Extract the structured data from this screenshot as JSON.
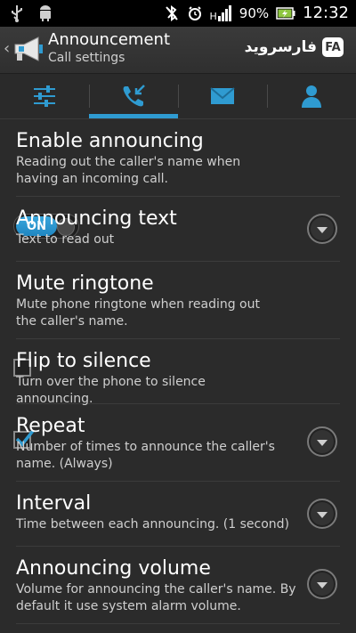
{
  "status_bar": {
    "left_icons": [
      "usb-icon",
      "android-icon"
    ],
    "right_icons": [
      "bluetooth-off-icon",
      "alarm-clock-icon",
      "signal-icon",
      "battery-charging-icon"
    ],
    "network_label": "H",
    "battery": "90%",
    "time": "12:32"
  },
  "action_bar": {
    "back": "‹",
    "title": "Announcement",
    "subtitle": "Call settings",
    "brand_text": "فارسروید",
    "brand_badge": "FA",
    "logo_icon": "megaphone-icon"
  },
  "tabs": [
    {
      "icon": "sliders-icon",
      "active": false
    },
    {
      "icon": "phone-incoming-icon",
      "active": true
    },
    {
      "icon": "envelope-icon",
      "active": false
    },
    {
      "icon": "person-icon",
      "active": false
    }
  ],
  "accent_color": "#2f9bd1",
  "settings": [
    {
      "title": "Enable announcing",
      "summary": "Reading out the caller's name when having an incoming call.",
      "control": "toggle",
      "toggle_label": "ON"
    },
    {
      "title": "Announcing text",
      "summary": "Text to read out",
      "control": "dropdown"
    },
    {
      "title": "Mute ringtone",
      "summary": "Mute phone ringtone when reading out the caller's name.",
      "control": "checkbox",
      "checked": false
    },
    {
      "title": "Flip to silence",
      "summary": "Turn over the phone to silence announcing.",
      "control": "checkbox",
      "checked": true
    },
    {
      "title": "Repeat",
      "summary": "Number of times to announce the caller's name. (Always)",
      "control": "dropdown"
    },
    {
      "title": "Interval",
      "summary": "Time between each announcing. (1 second)",
      "control": "dropdown"
    },
    {
      "title": "Announcing volume",
      "summary": "Volume for announcing the caller's name. By default it use system alarm volume.",
      "control": "dropdown"
    }
  ]
}
